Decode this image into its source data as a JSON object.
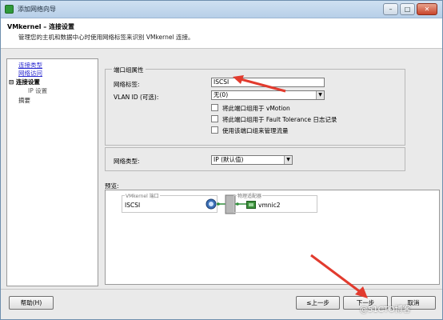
{
  "window": {
    "title": "添加网络向导",
    "controls": {
      "minimize": "–",
      "maximize": "□",
      "close": "✕"
    }
  },
  "header": {
    "title": "VMkernel – 连接设置",
    "subtitle": "管理您的主机和数据中心时使用网络标签来识别 VMkernel 连接。"
  },
  "nav": {
    "items": [
      {
        "label": "连接类型"
      },
      {
        "label": "网络访问"
      },
      {
        "prefix": "⊟",
        "label": "连接设置"
      },
      {
        "label": "IP 设置"
      },
      {
        "label": "摘要"
      }
    ]
  },
  "port_group": {
    "legend": "端口组属性",
    "network_label_label": "网络标签:",
    "network_label_value": "ISCSI",
    "vlan_label": "VLAN ID (可选):",
    "vlan_value": "无(0)",
    "checkboxes": [
      {
        "label": "将此端口组用于 vMotion",
        "checked": false
      },
      {
        "label": "将此端口组用于 Fault Tolerance 日志记录",
        "checked": false
      },
      {
        "label": "使用该端口组来管理流量",
        "checked": false
      }
    ]
  },
  "network_type": {
    "label": "网络类型:",
    "value": "IP (默认值)"
  },
  "preview": {
    "label": "预览:",
    "vmkernel_caption": "VMkernel 端口",
    "port_name": "ISCSI",
    "adapter_caption": "物理适配器",
    "nic_name": "vmnic2"
  },
  "buttons": {
    "help": "帮助(H)",
    "back": "≤上一步",
    "next": "下一步",
    "cancel": "取消"
  },
  "watermark": "@51CTO博客",
  "colors": {
    "annotation_arrow": "#e23b2e",
    "link": "#2a2ad0",
    "titlebar": "#b7cfe8"
  }
}
